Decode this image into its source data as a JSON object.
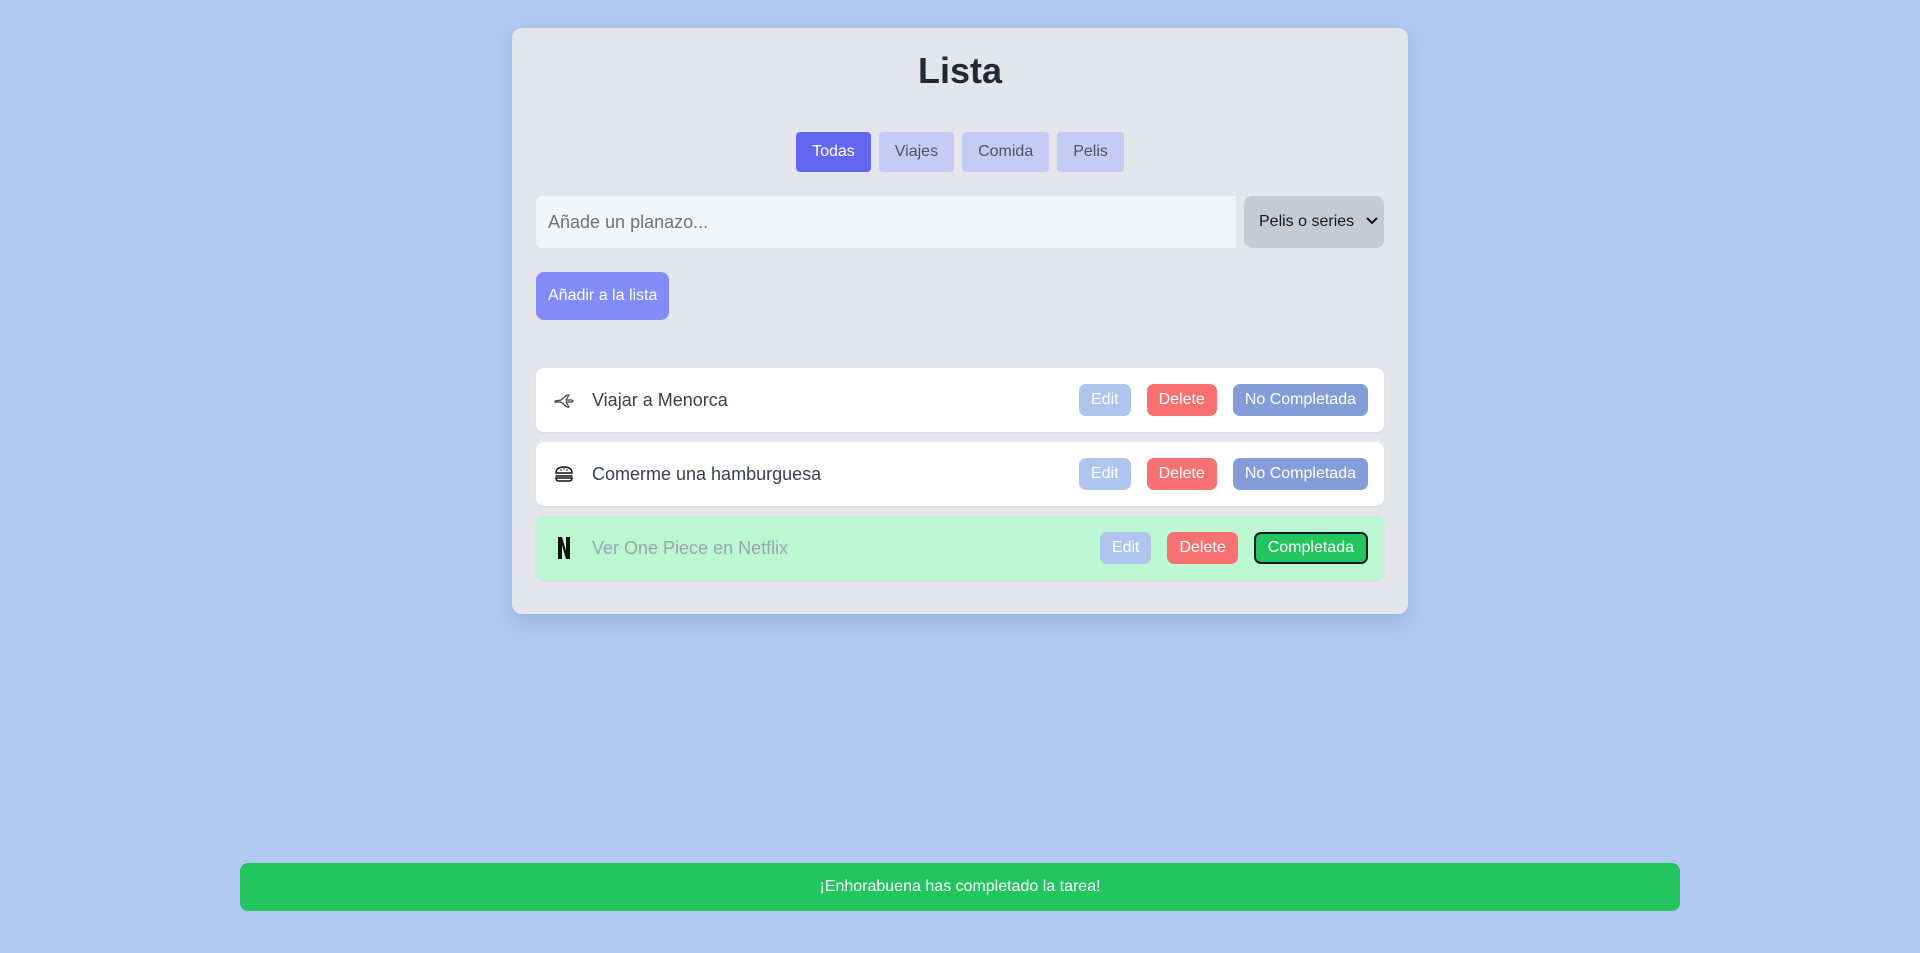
{
  "app": {
    "title": "Lista"
  },
  "filters": [
    {
      "label": "Todas",
      "active": true
    },
    {
      "label": "Viajes",
      "active": false
    },
    {
      "label": "Comida",
      "active": false
    },
    {
      "label": "Pelis",
      "active": false
    }
  ],
  "new_task": {
    "placeholder": "Añade un planazo...",
    "value": "",
    "category_selected": "Pelis o series",
    "add_label": "Añadir a la lista"
  },
  "tasks": [
    {
      "icon": "airplane-icon",
      "text": "Viajar a Menorca",
      "edit_label": "Edit",
      "delete_label": "Delete",
      "status_label": "No Completada",
      "completed": false
    },
    {
      "icon": "hamburger-icon",
      "text": "Comerme una hamburguesa",
      "edit_label": "Edit",
      "delete_label": "Delete",
      "status_label": "No Completada",
      "completed": false
    },
    {
      "icon": "netflix-icon",
      "text": "Ver One Piece en Netflix",
      "edit_label": "Edit",
      "delete_label": "Delete",
      "status_label": "Completada",
      "completed": true
    }
  ],
  "toast": {
    "message": "¡Enhorabuena has completado la tarea!"
  },
  "colors": {
    "background": "#b1c9f2",
    "card": "#e4e6eb",
    "accent": "#6366f1",
    "success": "#22c55e",
    "danger": "#f87171"
  }
}
